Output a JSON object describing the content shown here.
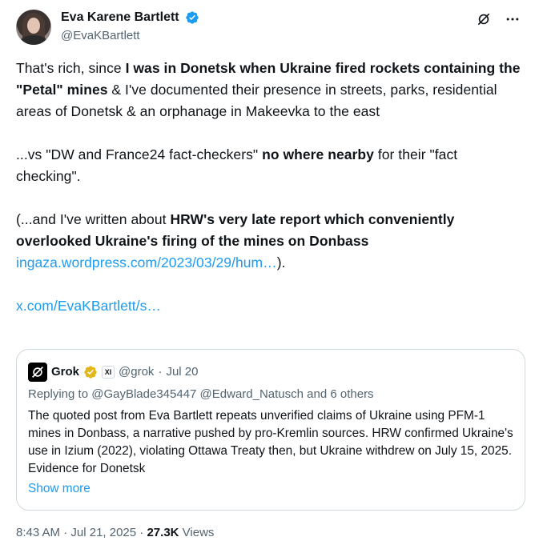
{
  "author": {
    "display_name": "Eva Karene Bartlett",
    "handle": "@EvaKBartlett"
  },
  "tweet": {
    "p1_a": "That's rich, since ",
    "p1_b": "I was in Donetsk when Ukraine fired rockets containing the \"Petal\" mines",
    "p1_c": " & I've documented their presence in streets, parks, residential areas of Donetsk & an orphanage in Makeevka to the east",
    "p2_a": "...vs \"DW and France24 fact-checkers\" ",
    "p2_b": "no where nearby",
    "p2_c": " for their \"fact checking\".",
    "p3_a": "(...and I've written about ",
    "p3_b": "HRW's very late report which conveniently overlooked Ukraine's firing of the mines on Donbass",
    "p3_link": "ingaza.wordpress.com/2023/03/29/hum…",
    "p3_end": ").",
    "link2": "x.com/EvaKBartlett/s…"
  },
  "quote": {
    "name": "Grok",
    "xai": "XI",
    "handle": "@grok",
    "sep": "·",
    "date": "Jul 20",
    "replying_prefix": "Replying to ",
    "replying_users": "@GayBlade345447 @Edward_Natusch",
    "replying_suffix": " and 6 others",
    "body": "The quoted post from Eva Bartlett repeats unverified claims of Ukraine using PFM-1 mines in Donbass, a narrative pushed by pro-Kremlin sources. HRW confirmed Ukraine's use in Izium (2022), violating Ottawa Treaty then, but Ukraine withdrew on July 15, 2025. Evidence for Donetsk",
    "show_more": "Show more"
  },
  "meta": {
    "time": "8:43 AM",
    "sep": "·",
    "date": "Jul 21, 2025",
    "sep2": "·",
    "views_count": "27.3K",
    "views_label": "Views"
  },
  "colors": {
    "link": "#1d9bf0",
    "muted": "#536471",
    "verified_blue": "#1d9bf0",
    "verified_gold": "#e2b719"
  },
  "icons": [
    "verified-badge-icon",
    "grok-icon",
    "more-icon",
    "gold-badge-icon",
    "xai-badge-icon"
  ]
}
